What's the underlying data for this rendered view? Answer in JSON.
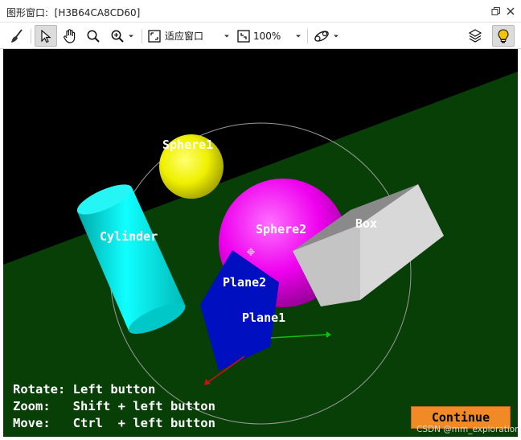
{
  "window": {
    "title": "图形窗口:  [H3B64CA8CD60]"
  },
  "toolbar": {
    "items": [
      "brush-icon",
      "select-arrow-icon",
      "pan-hand-icon",
      "zoom-icon",
      "zoom-in-icon",
      "fit-window-icon",
      "zoom-percent-icon",
      "orbit-icon",
      "layers-icon",
      "lightbulb-icon"
    ],
    "fit_label": "适应窗口",
    "zoom_label": "100%"
  },
  "scene": {
    "colors": {
      "background": "#000000",
      "ground": "#073f07",
      "sphere1": "#e6e600",
      "sphere2": "#e600e6",
      "cylinder": "#00e0e0",
      "box": "#c8c8c8",
      "plane": "#0010c0"
    },
    "labels": {
      "sphere1": "Sphere1",
      "sphere2": "Sphere2",
      "cylinder": "Cylinder",
      "box": "Box",
      "plane1": "Plane1",
      "plane2": "Plane2"
    }
  },
  "help": {
    "rotate": "Rotate: Left button",
    "zoom": "Zoom:   Shift + left button",
    "move": "Move:   Ctrl  + left button"
  },
  "continue_label": "Continue",
  "watermark": "CSDN @mm_exploration"
}
